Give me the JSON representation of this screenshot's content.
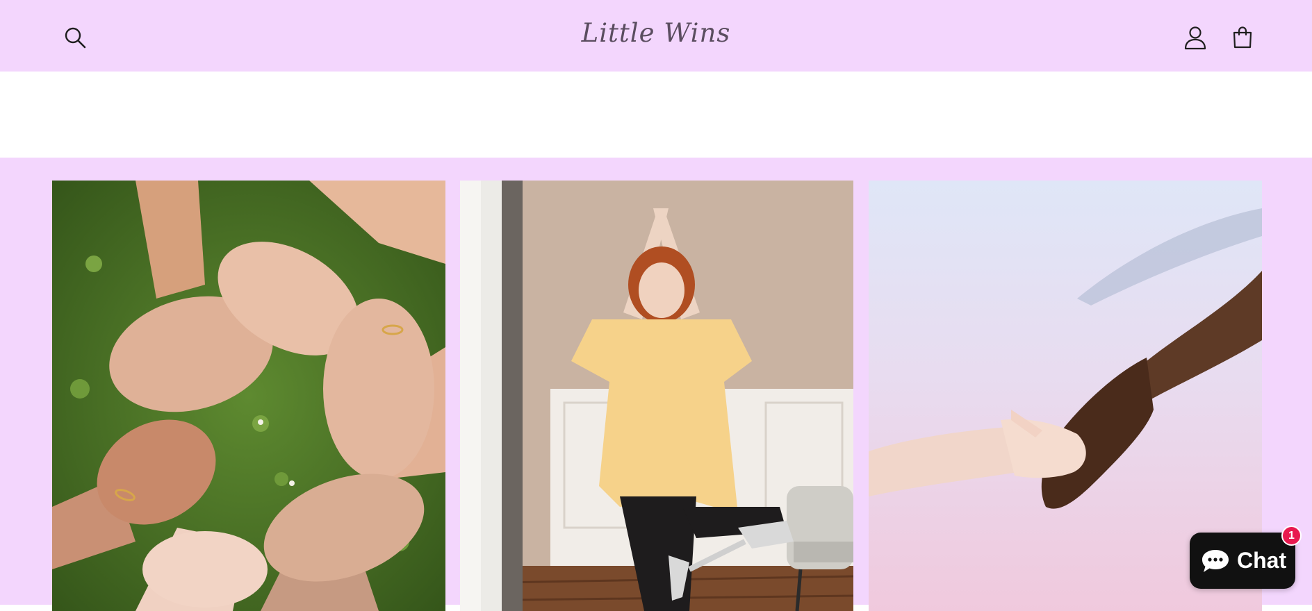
{
  "header": {
    "brand": "Little Wins",
    "background": "#f3d6fd",
    "icons": {
      "search": "search-icon",
      "account": "account-icon",
      "cart": "cart-icon"
    }
  },
  "gallery": {
    "background": "#f3d6fd",
    "images": [
      {
        "name": "hands-circle-image",
        "alt": ""
      },
      {
        "name": "yoga-pose-image",
        "alt": ""
      },
      {
        "name": "holding-hands-image",
        "alt": ""
      }
    ]
  },
  "chat": {
    "label": "Chat",
    "badge_count": "1",
    "icon": "chat-bubble-icon",
    "badge_color": "#e8194f"
  }
}
